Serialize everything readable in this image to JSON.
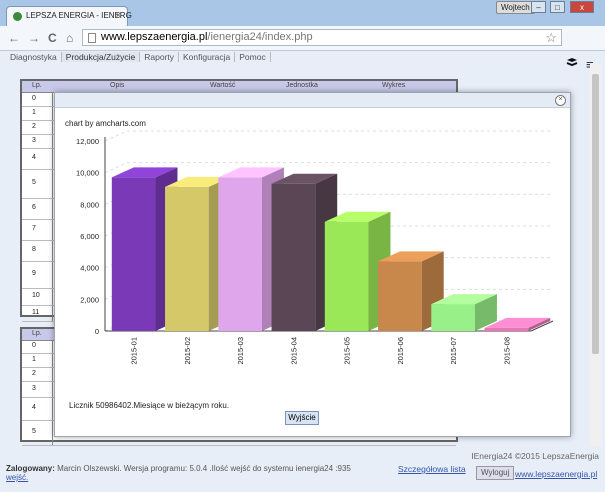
{
  "browser": {
    "tab_title": "LEPSZA ENERGIA - IENERG",
    "tab_close": "×",
    "user_badge": "Wojtech",
    "url_host": "www.lepszaenergia.pl",
    "url_path": "/ienergia24/index.php",
    "back_icon": "←",
    "forward_icon": "→",
    "reload_icon": "C",
    "home_icon": "⌂",
    "star_icon": "☆",
    "menu_icon": "≡",
    "min_icon": "–",
    "max_icon": "□",
    "close_icon": "x"
  },
  "nav": {
    "items": [
      "Diagnostyka",
      "Produkcja/Zużycie",
      "Raporty",
      "Konfiguracja",
      "Pomoc"
    ],
    "active_index": 1
  },
  "table1": {
    "headers": [
      "Lp.",
      "Opis",
      "Wartość",
      "Jednostka",
      "Wykres"
    ],
    "rows": [
      "0",
      "1",
      "2",
      "3",
      "4",
      "5",
      "6",
      "7",
      "8",
      "9",
      "10",
      "11"
    ]
  },
  "table2": {
    "headers": [
      "Lp."
    ],
    "rows": [
      "0",
      "1",
      "2",
      "3",
      "4",
      "5"
    ]
  },
  "modal": {
    "close_icon": "×",
    "credit": "chart by amcharts.com",
    "footnote": "Licznik 50986402.Miesiące w bieżącym roku.",
    "close_button": "Wyjście"
  },
  "chart_data": {
    "type": "bar",
    "categories": [
      "2015-01",
      "2015-02",
      "2015-03",
      "2015-04",
      "2015-05",
      "2015-06",
      "2015-07",
      "2015-08"
    ],
    "values": [
      9700,
      9100,
      9700,
      9300,
      6900,
      4400,
      1700,
      200
    ],
    "colors": [
      "#7a3ab8",
      "#d4c868",
      "#e0a6ec",
      "#5a4654",
      "#9ae858",
      "#c8884c",
      "#98f088",
      "#e878b4"
    ],
    "ylim": [
      0,
      12000
    ],
    "yticks": [
      "0",
      "2,000",
      "4,000",
      "6,000",
      "8,000",
      "10,000",
      "12,000"
    ],
    "grid": true,
    "style": "3d"
  },
  "status": {
    "copyright": "IEnergia24 ©2015 LepszaEnergia",
    "login_label": "Zalogowany:",
    "login_text": " Marcin Olszewski. Wersja programu: 5.0.4 .Ilość wejść do systemu ienergia24 :935",
    "login_link": "wejść.",
    "details_link": "Szczegółowa lista",
    "logout_button": "Wyloguj",
    "site_link": "www.lepszaenergia.pl"
  }
}
